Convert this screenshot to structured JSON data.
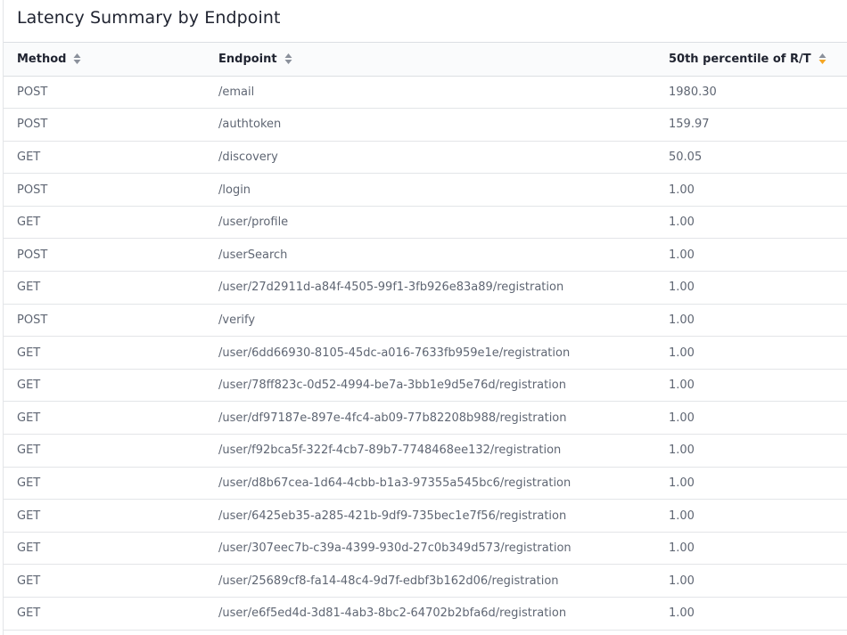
{
  "panel": {
    "title": "Latency Summary by Endpoint"
  },
  "table": {
    "columns": [
      {
        "label": "Method",
        "sort_icon": "sort-both-icon"
      },
      {
        "label": "Endpoint",
        "sort_icon": "sort-both-icon"
      },
      {
        "label": "50th percentile of R/T",
        "sort_icon": "sort-desc-active-icon"
      }
    ],
    "active_sort_color": "#f5a623",
    "rows": [
      {
        "method": "POST",
        "endpoint": "/email",
        "p50": "1980.30"
      },
      {
        "method": "POST",
        "endpoint": "/authtoken",
        "p50": "159.97"
      },
      {
        "method": "GET",
        "endpoint": "/discovery",
        "p50": "50.05"
      },
      {
        "method": "POST",
        "endpoint": "/login",
        "p50": "1.00"
      },
      {
        "method": "GET",
        "endpoint": "/user/profile",
        "p50": "1.00"
      },
      {
        "method": "POST",
        "endpoint": "/userSearch",
        "p50": "1.00"
      },
      {
        "method": "GET",
        "endpoint": "/user/27d2911d-a84f-4505-99f1-3fb926e83a89/registration",
        "p50": "1.00"
      },
      {
        "method": "POST",
        "endpoint": "/verify",
        "p50": "1.00"
      },
      {
        "method": "GET",
        "endpoint": "/user/6dd66930-8105-45dc-a016-7633fb959e1e/registration",
        "p50": "1.00"
      },
      {
        "method": "GET",
        "endpoint": "/user/78ff823c-0d52-4994-be7a-3bb1e9d5e76d/registration",
        "p50": "1.00"
      },
      {
        "method": "GET",
        "endpoint": "/user/df97187e-897e-4fc4-ab09-77b82208b988/registration",
        "p50": "1.00"
      },
      {
        "method": "GET",
        "endpoint": "/user/f92bca5f-322f-4cb7-89b7-7748468ee132/registration",
        "p50": "1.00"
      },
      {
        "method": "GET",
        "endpoint": "/user/d8b67cea-1d64-4cbb-b1a3-97355a545bc6/registration",
        "p50": "1.00"
      },
      {
        "method": "GET",
        "endpoint": "/user/6425eb35-a285-421b-9df9-735bec1e7f56/registration",
        "p50": "1.00"
      },
      {
        "method": "GET",
        "endpoint": "/user/307eec7b-c39a-4399-930d-27c0b349d573/registration",
        "p50": "1.00"
      },
      {
        "method": "GET",
        "endpoint": "/user/25689cf8-fa14-48c4-9d7f-edbf3b162d06/registration",
        "p50": "1.00"
      },
      {
        "method": "GET",
        "endpoint": "/user/e6f5ed4d-3d81-4ab3-8bc2-64702b2bfa6d/registration",
        "p50": "1.00"
      }
    ]
  }
}
